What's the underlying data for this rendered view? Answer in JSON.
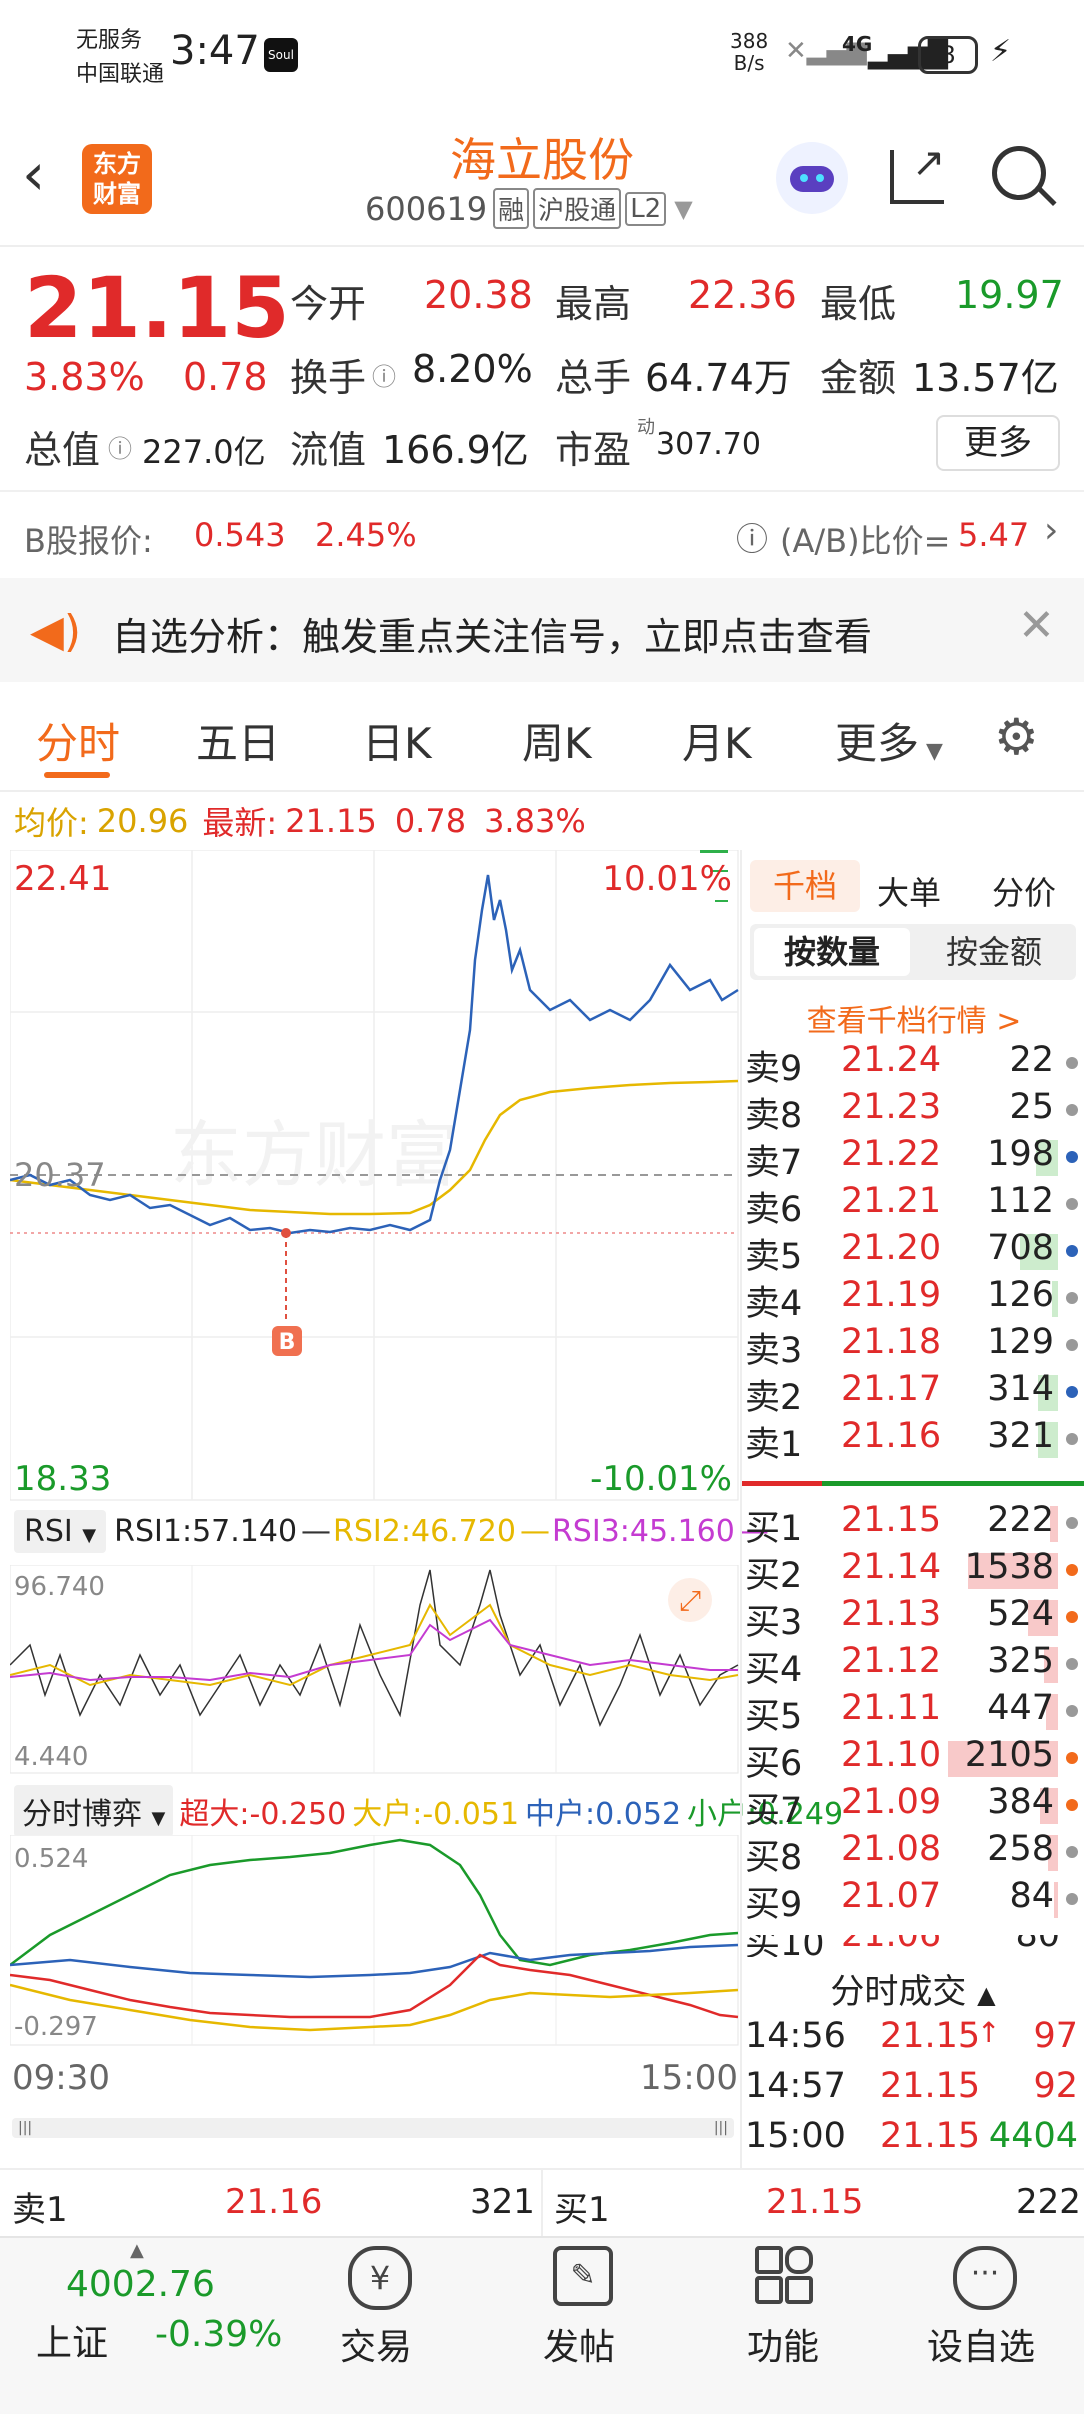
{
  "status_bar": {
    "carrier_line1": "无服务",
    "carrier_line2": "中国联通",
    "time": "3:47",
    "app_badge": "Soul",
    "net_speed_top": "388",
    "net_speed_bottom": "B/s",
    "network": "4G",
    "battery": "8"
  },
  "header": {
    "logo_line1": "东方",
    "logo_line2": "财富",
    "stock_name": "海立股份",
    "stock_code": "600619",
    "tag_margin": "融",
    "tag_connect": "沪股通",
    "tag_level": "L2"
  },
  "quote": {
    "price": "21.15",
    "change_pct": "3.83%",
    "change": "0.78",
    "open_label": "今开",
    "open": "20.38",
    "high_label": "最高",
    "high": "22.36",
    "low_label": "最低",
    "low": "19.97",
    "turnover_label": "换手",
    "turnover": "8.20%",
    "volume_label": "总手",
    "volume": "64.74万",
    "amount_label": "金额",
    "amount": "13.57亿",
    "mktcap_label": "总值",
    "mktcap": "227.0亿",
    "float_label": "流值",
    "float": "166.9亿",
    "pe_label": "市盈",
    "pe_sup": "动",
    "pe": "307.70",
    "more": "更多",
    "b_label": "B股报价:",
    "b_price": "0.543",
    "b_pct": "2.45%",
    "ab_ratio_label": "(A/B)比价=",
    "ab_ratio": "5.47"
  },
  "notice": {
    "text": "自选分析：触发重点关注信号，立即点击查看"
  },
  "tabs": [
    "分时",
    "五日",
    "日K",
    "周K",
    "月K",
    "更多"
  ],
  "intraday": {
    "avg_label": "均价:",
    "avg": "20.96",
    "latest_label": "最新:",
    "latest": "21.15",
    "latest_change": "0.78",
    "latest_pct": "3.83%",
    "y_max": "22.41",
    "y_max_pct": "10.01%",
    "y_prev": "20.37",
    "y_min": "18.33",
    "y_min_pct": "-10.01%",
    "marker": "B",
    "watermark": "东方财富",
    "time_start": "09:30",
    "time_end": "15:00"
  },
  "rsi": {
    "select": "RSI",
    "rsi1": "RSI1:57.140",
    "rsi2": "RSI2:46.720",
    "rsi3": "RSI3:45.160",
    "y_max": "96.740",
    "y_min": "4.440"
  },
  "flow": {
    "select": "分时博弈",
    "super": "超大:-0.250",
    "big": "大户:-0.051",
    "mid": "中户:0.052",
    "small": "小户:0.249",
    "y_max": "0.524",
    "y_min": "-0.297"
  },
  "orderbook": {
    "tabs": [
      "千档",
      "大单",
      "分价"
    ],
    "subtabs": [
      "按数量",
      "按金额"
    ],
    "link": "查看千档行情 >",
    "asks": [
      {
        "label": "卖9",
        "price": "21.24",
        "qty": "22"
      },
      {
        "label": "卖8",
        "price": "21.23",
        "qty": "25"
      },
      {
        "label": "卖7",
        "price": "21.22",
        "qty": "198"
      },
      {
        "label": "卖6",
        "price": "21.21",
        "qty": "112"
      },
      {
        "label": "卖5",
        "price": "21.20",
        "qty": "708"
      },
      {
        "label": "卖4",
        "price": "21.19",
        "qty": "126"
      },
      {
        "label": "卖3",
        "price": "21.18",
        "qty": "129"
      },
      {
        "label": "卖2",
        "price": "21.17",
        "qty": "314"
      },
      {
        "label": "卖1",
        "price": "21.16",
        "qty": "321"
      }
    ],
    "bids": [
      {
        "label": "买1",
        "price": "21.15",
        "qty": "222"
      },
      {
        "label": "买2",
        "price": "21.14",
        "qty": "1538"
      },
      {
        "label": "买3",
        "price": "21.13",
        "qty": "524"
      },
      {
        "label": "买4",
        "price": "21.12",
        "qty": "325"
      },
      {
        "label": "买5",
        "price": "21.11",
        "qty": "447"
      },
      {
        "label": "买6",
        "price": "21.10",
        "qty": "2105"
      },
      {
        "label": "买7",
        "price": "21.09",
        "qty": "384"
      },
      {
        "label": "买8",
        "price": "21.08",
        "qty": "258"
      },
      {
        "label": "买9",
        "price": "21.07",
        "qty": "84"
      }
    ],
    "trades_title": "分时成交",
    "trades": [
      {
        "time": "14:56",
        "price": "21.15",
        "arrow": "↑",
        "vol": "97"
      },
      {
        "time": "14:57",
        "price": "21.15",
        "arrow": "",
        "vol": "92"
      },
      {
        "time": "15:00",
        "price": "21.15",
        "arrow": "",
        "vol": "4404"
      }
    ]
  },
  "bottom_quote": {
    "ask_label": "卖1",
    "ask_price": "21.16",
    "ask_qty": "321",
    "bid_label": "买1",
    "bid_price": "21.15",
    "bid_qty": "222"
  },
  "bottom_nav": {
    "index_value": "4002.76",
    "index_name": "上证",
    "index_pct": "-0.39%",
    "items": [
      "交易",
      "发帖",
      "功能",
      "设自选"
    ]
  },
  "colors": {
    "up": "#e02a2a",
    "down": "#1a9a2a",
    "accent": "#f26a1b",
    "price_line": "#2c62b8",
    "avg_line": "#e6b800"
  }
}
